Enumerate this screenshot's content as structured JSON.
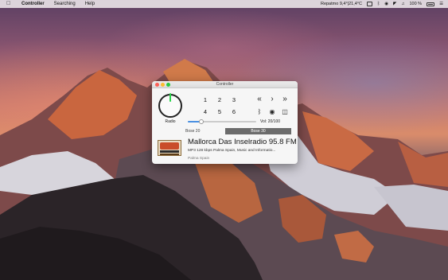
{
  "menubar": {
    "apple_icon": "apple-icon",
    "app_name": "Controller",
    "menus": [
      "Searching",
      "Help"
    ],
    "status_text": "Repatmo 9,4°|21,4°C",
    "battery_text": "100 %"
  },
  "window": {
    "title": "Controller",
    "radio_label": "Radio",
    "presets": [
      "1",
      "2",
      "3",
      "4",
      "5",
      "6"
    ],
    "nav": {
      "rewind": "«",
      "next": "›",
      "fast_forward": "»"
    },
    "volume": {
      "label": "Vol: 20/100",
      "value": 20,
      "max": 100
    },
    "bose_left": "Bose 20",
    "bose_right": "Bose 30",
    "station": {
      "name": "Mallorca Das Inselradio 95.8 FM",
      "meta": "MP3 128 kbps  Palma Spain,  Music and Informatio...",
      "location": "Palma Spain"
    }
  },
  "colors": {
    "knob_pointer": "#2ad34b",
    "volume_fill": "#4a90e2",
    "bose_bar": "#6b6b6b"
  }
}
